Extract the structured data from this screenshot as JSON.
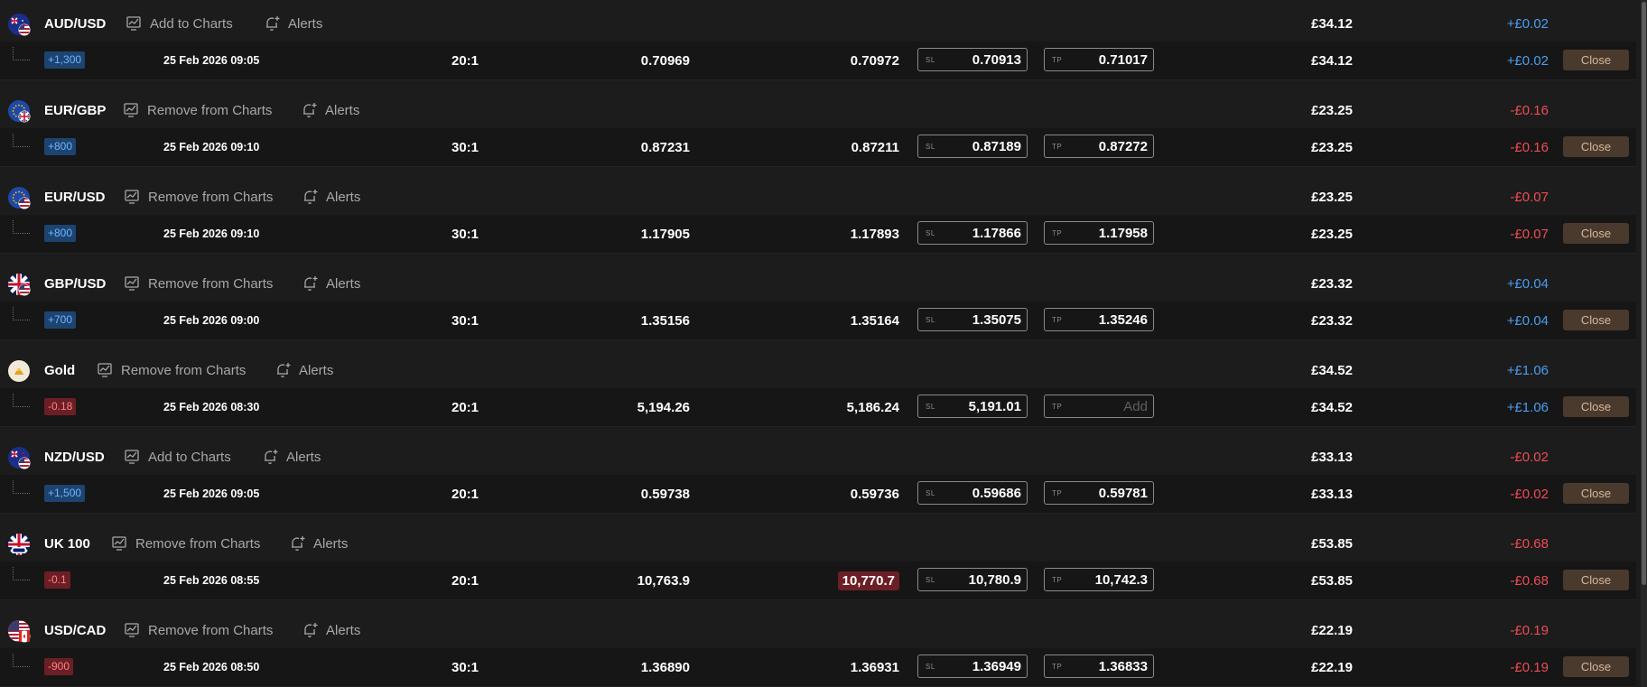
{
  "actions": {
    "add_to_charts": "Add to Charts",
    "remove_from_charts": "Remove from Charts",
    "alerts": "Alerts",
    "close": "Close",
    "sl_label": "SL",
    "tp_label": "TP",
    "tp_add": "Add"
  },
  "rows": [
    {
      "symbol": "AUD/USD",
      "flag": "au-us-flag",
      "in_chart": false,
      "margin": "£34.12",
      "pnl": "+£0.02",
      "pnl_sign": "pos",
      "qty": "+1,300",
      "side": "buy",
      "date": "25 Feb 2026 09:05",
      "leverage": "20:1",
      "open_price": "0.70969",
      "current_price": "0.70972",
      "current_highlight": false,
      "sl": "0.70913",
      "tp": "0.71017"
    },
    {
      "symbol": "EUR/GBP",
      "flag": "eu-gb-flag",
      "in_chart": true,
      "margin": "£23.25",
      "pnl": "-£0.16",
      "pnl_sign": "neg",
      "qty": "+800",
      "side": "buy",
      "date": "25 Feb 2026 09:10",
      "leverage": "30:1",
      "open_price": "0.87231",
      "current_price": "0.87211",
      "current_highlight": false,
      "sl": "0.87189",
      "tp": "0.87272"
    },
    {
      "symbol": "EUR/USD",
      "flag": "eu-us-flag",
      "in_chart": true,
      "margin": "£23.25",
      "pnl": "-£0.07",
      "pnl_sign": "neg",
      "qty": "+800",
      "side": "buy",
      "date": "25 Feb 2026 09:10",
      "leverage": "30:1",
      "open_price": "1.17905",
      "current_price": "1.17893",
      "current_highlight": false,
      "sl": "1.17866",
      "tp": "1.17958"
    },
    {
      "symbol": "GBP/USD",
      "flag": "gb-us-flag",
      "in_chart": true,
      "margin": "£23.32",
      "pnl": "+£0.04",
      "pnl_sign": "pos",
      "qty": "+700",
      "side": "buy",
      "date": "25 Feb 2026 09:00",
      "leverage": "30:1",
      "open_price": "1.35156",
      "current_price": "1.35164",
      "current_highlight": false,
      "sl": "1.35075",
      "tp": "1.35246"
    },
    {
      "symbol": "Gold",
      "flag": "gold-bars-icon",
      "in_chart": true,
      "margin": "£34.52",
      "pnl": "+£1.06",
      "pnl_sign": "pos",
      "qty": "-0.18",
      "side": "sell",
      "date": "25 Feb 2026 08:30",
      "leverage": "20:1",
      "open_price": "5,194.26",
      "current_price": "5,186.24",
      "current_highlight": false,
      "sl": "5,191.01",
      "tp": ""
    },
    {
      "symbol": "NZD/USD",
      "flag": "nz-us-flag",
      "in_chart": false,
      "margin": "£33.13",
      "pnl": "-£0.02",
      "pnl_sign": "neg",
      "qty": "+1,500",
      "side": "buy",
      "date": "25 Feb 2026 09:05",
      "leverage": "20:1",
      "open_price": "0.59738",
      "current_price": "0.59736",
      "current_highlight": false,
      "sl": "0.59686",
      "tp": "0.59781"
    },
    {
      "symbol": "UK 100",
      "flag": "uk100-flag",
      "in_chart": true,
      "margin": "£53.85",
      "pnl": "-£0.68",
      "pnl_sign": "neg",
      "qty": "-0.1",
      "side": "sell",
      "date": "25 Feb 2026 08:55",
      "leverage": "20:1",
      "open_price": "10,763.9",
      "current_price": "10,770.7",
      "current_highlight": true,
      "sl": "10,780.9",
      "tp": "10,742.3"
    },
    {
      "symbol": "USD/CAD",
      "flag": "us-ca-flag",
      "in_chart": true,
      "margin": "£22.19",
      "pnl": "-£0.19",
      "pnl_sign": "neg",
      "qty": "-900",
      "side": "sell",
      "date": "25 Feb 2026 08:50",
      "leverage": "30:1",
      "open_price": "1.36890",
      "current_price": "1.36931",
      "current_highlight": false,
      "sl": "1.36949",
      "tp": "1.36833"
    }
  ],
  "colors": {
    "background": "#1c1c1c",
    "positive": "#4a9ef0",
    "negative": "#ee4c55",
    "buy_badge": "#1d4470",
    "sell_badge": "#6b1f25",
    "close_button": "#4a3a2d"
  }
}
